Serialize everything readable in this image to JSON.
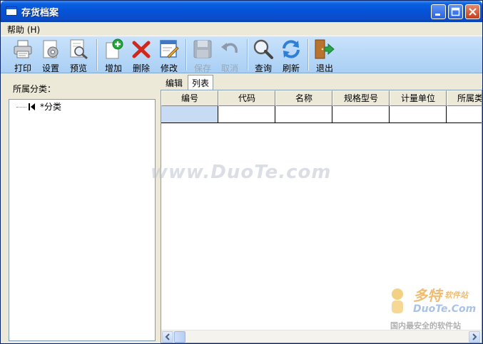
{
  "window": {
    "title": "存货档案",
    "colors": {
      "titlebar": "#0552d6",
      "toolbar": "#b9d8f7",
      "selected_cell": "#c7dcf4"
    }
  },
  "caption_buttons": [
    "minimize-icon",
    "maximize-icon",
    "close-icon"
  ],
  "menu": {
    "items": [
      {
        "label": "帮助 (H)"
      }
    ]
  },
  "toolbar": {
    "print": {
      "label": "打印",
      "icon": "printer-icon"
    },
    "settings": {
      "label": "设置",
      "icon": "settings-icon"
    },
    "preview": {
      "label": "预览",
      "icon": "preview-icon"
    },
    "add": {
      "label": "增加",
      "icon": "add-icon"
    },
    "delete": {
      "label": "删除",
      "icon": "delete-icon"
    },
    "modify": {
      "label": "修改",
      "icon": "edit-icon"
    },
    "save": {
      "label": "保存",
      "icon": "floppy-icon",
      "enabled": false
    },
    "cancel": {
      "label": "取消",
      "icon": "undo-icon",
      "enabled": false
    },
    "query": {
      "label": "查询",
      "icon": "magnifier-icon"
    },
    "refresh": {
      "label": "刷新",
      "icon": "refresh-icon"
    },
    "exit": {
      "label": "退出",
      "icon": "exit-door-icon"
    }
  },
  "left_panel": {
    "label": "所属分类：",
    "tree": [
      {
        "label": "*分类",
        "icon": "first-record-icon"
      }
    ]
  },
  "tabs": [
    {
      "label": "编辑",
      "active": false
    },
    {
      "label": "列表",
      "active": true
    }
  ],
  "grid": {
    "columns": [
      "编号",
      "代码",
      "名称",
      "规格型号",
      "计量单位",
      "所属类"
    ],
    "rows": [
      [
        "",
        "",
        "",
        "",
        "",
        ""
      ]
    ]
  },
  "watermarks": {
    "main": "www.DuoTe.com",
    "logo_cn": "多特",
    "logo_cn_sub": "软件站",
    "logo_en": "DuoTe.Com",
    "slogan": "国内最安全的软件站"
  }
}
